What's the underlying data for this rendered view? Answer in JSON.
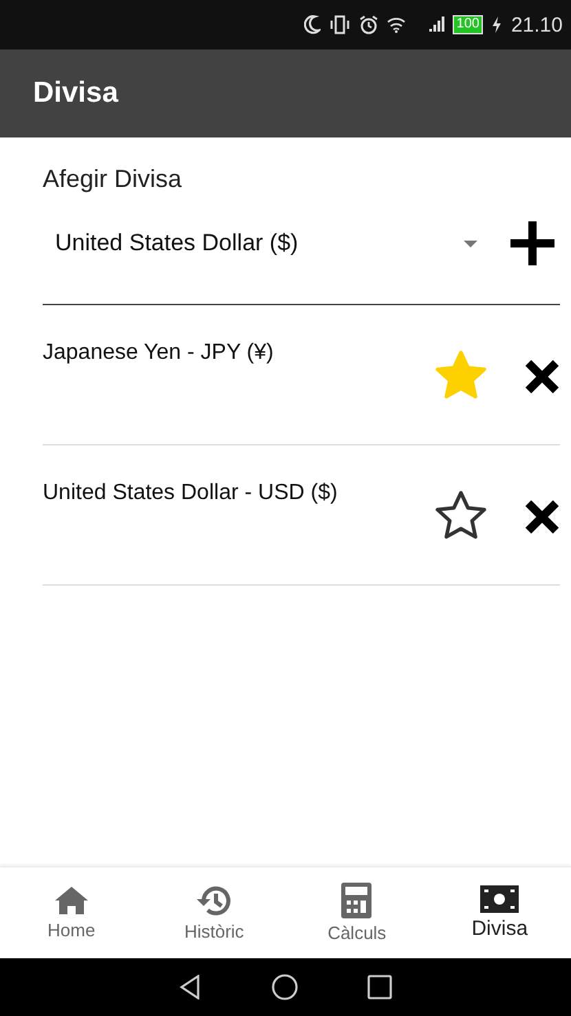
{
  "status_bar": {
    "battery": "100",
    "time": "21.10"
  },
  "app_bar": {
    "title": "Divisa"
  },
  "add_section": {
    "heading": "Afegir Divisa",
    "dropdown_value": "United States Dollar ($)"
  },
  "currencies": [
    {
      "name": "Japanese Yen - JPY (¥)",
      "favorite": true
    },
    {
      "name": "United States Dollar - USD ($)",
      "favorite": false
    }
  ],
  "bottom_nav": [
    {
      "kind": "home",
      "label": "Home",
      "selected": false
    },
    {
      "kind": "history",
      "label": "Històric",
      "selected": false
    },
    {
      "kind": "calculator",
      "label": "Càlculs",
      "selected": false
    },
    {
      "kind": "money",
      "label": "Divisa",
      "selected": true
    }
  ]
}
